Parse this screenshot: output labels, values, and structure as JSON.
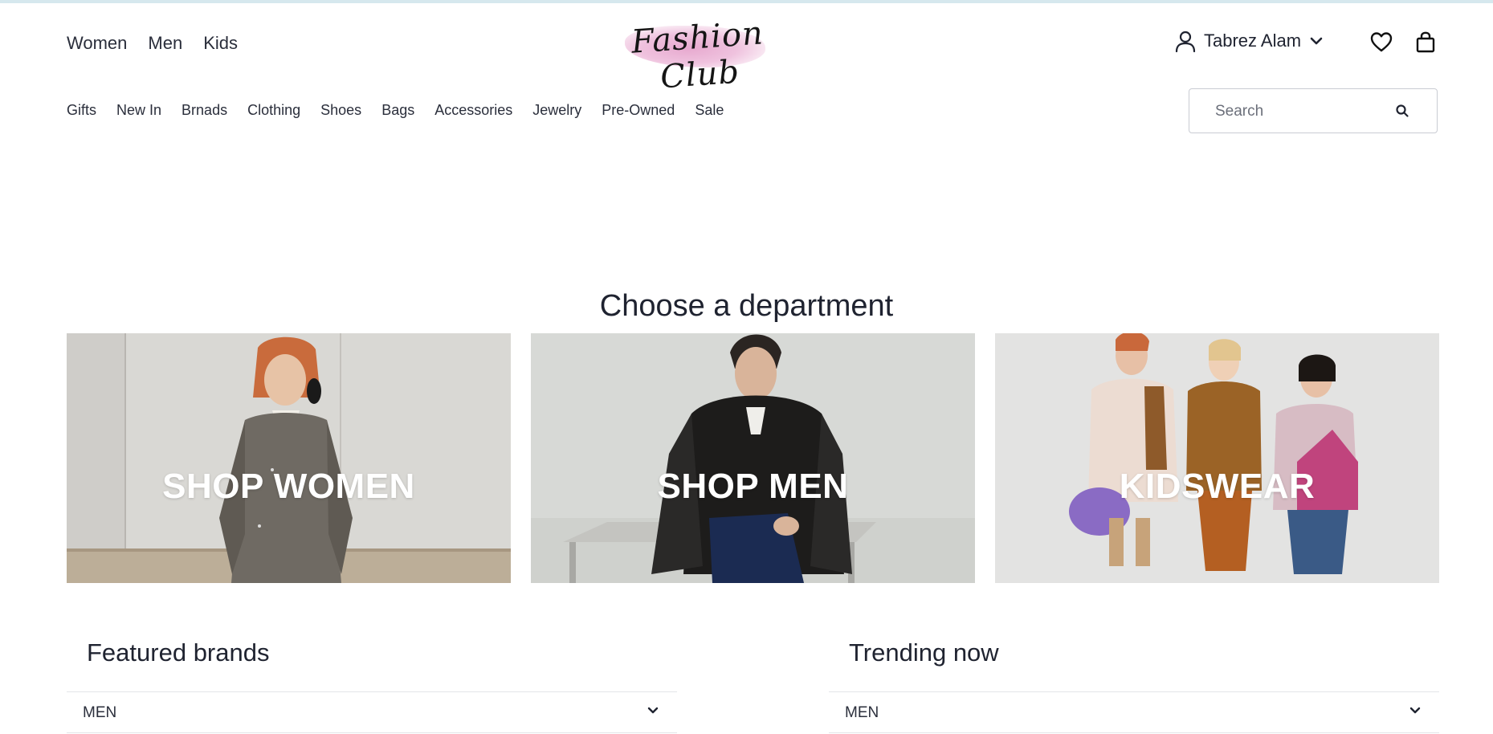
{
  "header": {
    "primary_nav": [
      "Women",
      "Men",
      "Kids"
    ],
    "logo_text": "Fashion Club",
    "user_name": "Tabrez Alam",
    "secondary_nav": [
      "Gifts",
      "New In",
      "Brnads",
      "Clothing",
      "Shoes",
      "Bags",
      "Accessories",
      "Jewelry",
      "Pre-Owned",
      "Sale"
    ],
    "search_placeholder": "Search"
  },
  "icons": {
    "user": "user-icon",
    "dropdown": "chevron-down-icon",
    "wishlist": "heart-icon",
    "cart": "shopping-bag-icon",
    "search": "search-icon"
  },
  "main": {
    "heading": "Choose a department",
    "departments": [
      {
        "label": "SHOP WOMEN"
      },
      {
        "label": "SHOP MEN"
      },
      {
        "label": "KIDSWEAR"
      }
    ],
    "featured_brands": {
      "title": "Featured brands",
      "accordion_label": "MEN"
    },
    "trending_now": {
      "title": "Trending now",
      "accordion_label": "MEN"
    }
  },
  "colors": {
    "text": "#1f2330",
    "border": "#c9ccd3",
    "logo_wash": "#e7a9cf",
    "card_label": "#ffffff"
  }
}
